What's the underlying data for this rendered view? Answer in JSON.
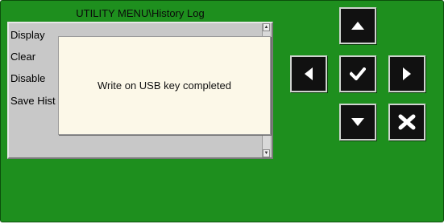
{
  "window": {
    "title": "UTILITY MENU\\History Log"
  },
  "menu": {
    "items": [
      {
        "label": "Display"
      },
      {
        "label": "Clear"
      },
      {
        "label": "Disable"
      },
      {
        "label": "Save Hist"
      }
    ]
  },
  "dialog": {
    "message": "Write on USB key completed"
  },
  "nav_buttons": [
    {
      "icon": "arrow-up-icon"
    },
    {
      "icon": "arrow-left-icon"
    },
    {
      "icon": "checkmark-icon"
    },
    {
      "icon": "arrow-right-icon"
    },
    {
      "icon": "arrow-down-icon"
    },
    {
      "icon": "cancel-x-icon"
    }
  ],
  "colors": {
    "background": "#1e8f1e",
    "panel": "#c8c8c8",
    "dialog": "#fcf8e8",
    "button": "#111111"
  }
}
